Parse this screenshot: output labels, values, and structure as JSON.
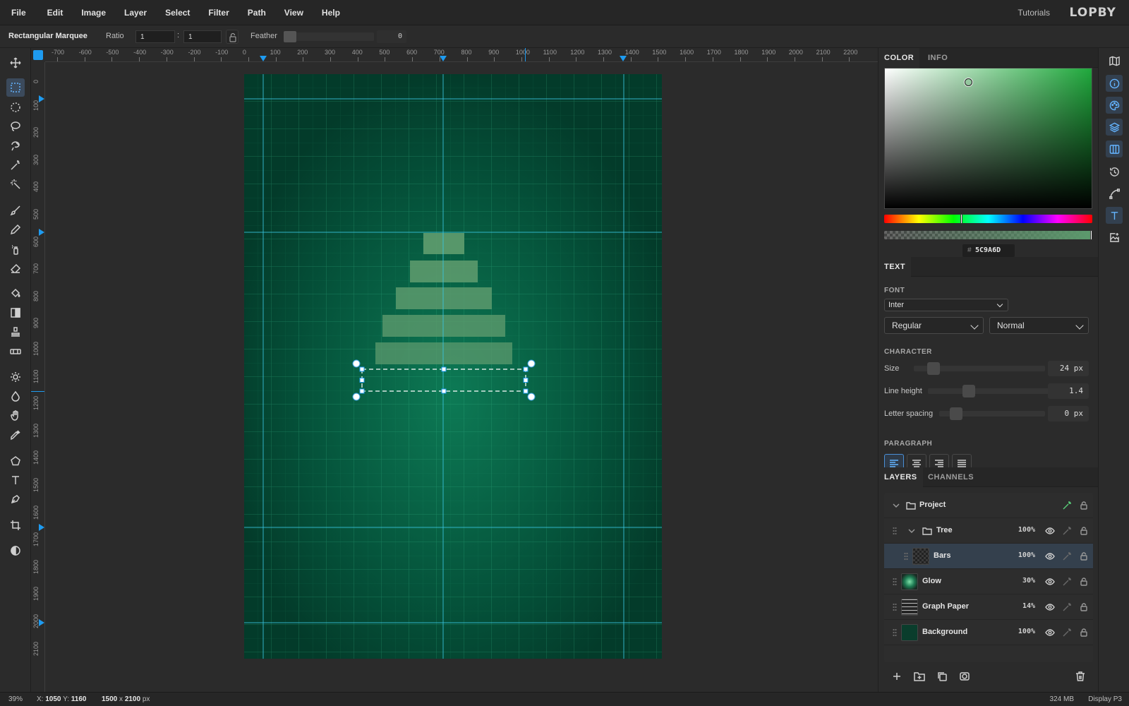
{
  "menu": [
    "File",
    "Edit",
    "Image",
    "Layer",
    "Select",
    "Filter",
    "Path",
    "View",
    "Help"
  ],
  "header": {
    "tutorials": "Tutorials",
    "logo": "LOPBY"
  },
  "options": {
    "tool_name": "Rectangular Marquee",
    "ratio_label": "Ratio",
    "ratio_w": "1",
    "ratio_sep": ":",
    "ratio_h": "1",
    "feather_label": "Feather",
    "feather_value": "0"
  },
  "ruler_top": [
    "-700",
    "-600",
    "-500",
    "-400",
    "-300",
    "-200",
    "-100",
    "0",
    "100",
    "200",
    "300",
    "400",
    "500",
    "600",
    "700",
    "800",
    "900",
    "1000",
    "1100",
    "1200",
    "1300",
    "1400",
    "1500",
    "1600",
    "1700",
    "1800",
    "1900",
    "2000",
    "2100",
    "2200"
  ],
  "ruler_left": [
    "0",
    "100",
    "200",
    "300",
    "400",
    "500",
    "600",
    "700",
    "800",
    "900",
    "1000",
    "1100",
    "1200",
    "1300",
    "1400",
    "1500",
    "1600",
    "1700",
    "1800",
    "1900",
    "2000",
    "2100"
  ],
  "color_panel": {
    "tabs": [
      "COLOR",
      "INFO"
    ],
    "hex_prefix": "#",
    "hex": "5C9A6D",
    "hue_fraction": 0.37,
    "picker_pos_fraction": 0.4
  },
  "text_panel": {
    "tab": "TEXT",
    "font_label": "FONT",
    "font_family": "Inter",
    "font_style": "Regular",
    "font_variant": "Normal",
    "character_label": "CHARACTER",
    "size_label": "Size",
    "size_value": "24 px",
    "size_fraction": 0.1,
    "line_height_label": "Line height",
    "line_height_value": "1.4",
    "line_height_fraction": 0.27,
    "letter_spacing_label": "Letter spacing",
    "letter_spacing_value": "0 px",
    "letter_spacing_fraction": 0.1,
    "paragraph_label": "PARAGRAPH"
  },
  "layers_panel": {
    "tabs": [
      "LAYERS",
      "CHANNELS"
    ],
    "layers": [
      {
        "name": "Project",
        "opacity": "",
        "type": "group"
      },
      {
        "name": "Tree",
        "opacity": "100%",
        "type": "group"
      },
      {
        "name": "Bars",
        "opacity": "100%",
        "type": "layer"
      },
      {
        "name": "Glow",
        "opacity": "30%",
        "type": "layer"
      },
      {
        "name": "Graph Paper",
        "opacity": "14%",
        "type": "layer"
      },
      {
        "name": "Background",
        "opacity": "100%",
        "type": "layer"
      }
    ]
  },
  "status": {
    "zoom": "39%",
    "x_label": "X:",
    "x_value": "1050",
    "y_label": "Y:",
    "y_value": "1160",
    "doc_w": "1500",
    "doc_x": "x",
    "doc_h": "2100",
    "doc_unit": "px",
    "memory": "324 MB",
    "display": "Display P3"
  },
  "colors": {
    "accent": "#1e9bf0",
    "canvas_bg": "#034a34",
    "bar_color": "#5c9a6d",
    "guide": "#38c6e0"
  }
}
